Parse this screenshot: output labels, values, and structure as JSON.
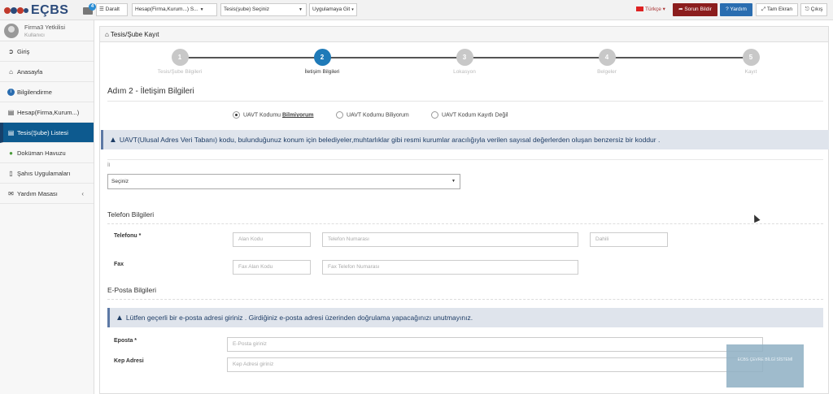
{
  "app": {
    "logo_text": "EÇBS",
    "mail_count": "4"
  },
  "topbar": {
    "toggle_label": "Daralt",
    "org_select": "Hesap(Firma,Kurum...) S...",
    "facility_select": "Tesis(şube) Seçiniz",
    "app_goto": "Uygulamaya Git",
    "language": "Türkçe",
    "report_label": "Sorun Bildir",
    "help_label": "Yardım",
    "fullscreen_label": "Tam Ekran",
    "logout_label": "Çıkış"
  },
  "user": {
    "name": "Firma3 Yetkilisi",
    "role": "Kullanıcı"
  },
  "sidebar": {
    "items": [
      {
        "label": "Giriş",
        "icon": "login-icon"
      },
      {
        "label": "Anasayfa",
        "icon": "home-icon"
      },
      {
        "label": "Bilgilendirme",
        "icon": "info-icon"
      },
      {
        "label": "Hesap(Firma,Kurum...)",
        "icon": "building-icon"
      },
      {
        "label": "Tesis(Şube) Listesi",
        "icon": "list-icon"
      },
      {
        "label": "Doküman Havuzu",
        "icon": "users-icon"
      },
      {
        "label": "Şahıs Uygulamaları",
        "icon": "file-icon"
      },
      {
        "label": "Yardım Masası",
        "icon": "envelope-icon"
      }
    ]
  },
  "panel": {
    "title": "Tesis/Şube Kayıt"
  },
  "steps": [
    {
      "num": "1",
      "label": "Tesis/Şube Bilgileri"
    },
    {
      "num": "2",
      "label": "İletişim Bilgileri"
    },
    {
      "num": "3",
      "label": "Lokasyon"
    },
    {
      "num": "4",
      "label": "Belgeler"
    },
    {
      "num": "5",
      "label": "Kayıt"
    }
  ],
  "step_heading": "Adım 2 - İletişim Bilgileri",
  "uavt": {
    "opt1_pre": "UAVT Kodumu ",
    "opt1_bold": "Bilmiyorum",
    "opt2": "UAVT Kodumu Biliyorum",
    "opt3": "UAVT Kodum Kayıtlı Değil",
    "info": "UAVT(Ulusal Adres Veri Tabanı) kodu, bulunduğunuz konum için belediyeler,muhtarlıklar gibi resmi kurumlar aracılığıyla verilen sayısal değerlerden oluşan benzersiz bir koddur ."
  },
  "il": {
    "label": "İl",
    "value": "Seçiniz"
  },
  "phone": {
    "section": "Telefon Bilgileri",
    "tel_label": "Telefonu *",
    "area_ph": "Alan Kodu",
    "number_ph": "Telefon Numarası",
    "ext_ph": "Dahili",
    "fax_label": "Fax",
    "fax_area_ph": "Fax Alan Kodu",
    "fax_number_ph": "Fax Telefon Numarası"
  },
  "email": {
    "section": "E-Posta Bilgileri",
    "info": "Lütfen geçerli bir e-posta adresi giriniz . Girdiğiniz e-posta adresi üzerinden doğrulama yapacağınızı unutmayınız.",
    "label": "Eposta *",
    "ph": "E-Posta giriniz",
    "kep_label": "Kep Adresi",
    "kep_ph": "Kep Adresi giriniz"
  },
  "ad": {
    "text": "ECBS ÇEVRE BİLGİ SİSTEMİ"
  }
}
